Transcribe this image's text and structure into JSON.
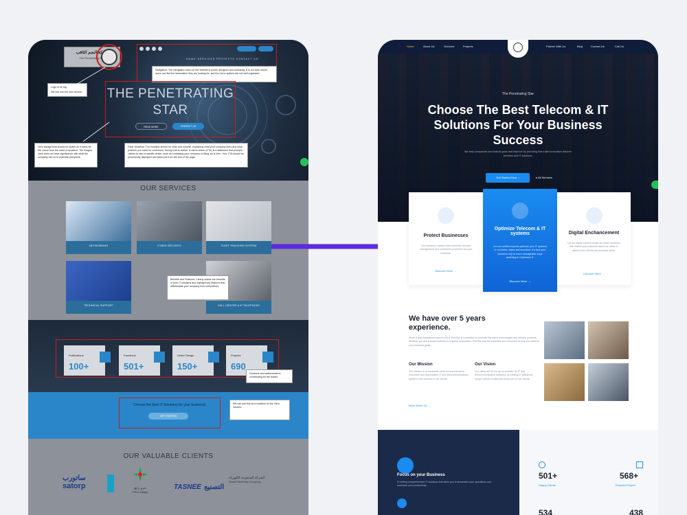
{
  "left": {
    "hero": {
      "logo_arabic": "شركة النجم الثاقب",
      "logo_english": "The Penetrating Star",
      "title_line1": "THE PENETRATING",
      "title_line2": "STAR",
      "btn_primary": "READ MORE",
      "btn_secondary": "CONTACT US",
      "nav_menu": "HOME   SERVICES   PROJECTS   CONTACT US"
    },
    "notes": {
      "logo": "Logo to be big.",
      "logo_sub": "We can use the new version",
      "nav": "Navigation: The navigation menu on the website is poorly designed and confusing. It is not clear where users can find the information they are looking for, and the menu options are not well-organized.",
      "background": "Hero background should be stylish as it does not the colour from the value proposition. The images used does not have significance with what the company can do to potential prospects.",
      "headline": "Clear Headline: The headline should be clear and concise, explaining what your company does and what problem you solve for customers. Strong Call-to-Action: A call-to-action (CTA) is a statement that prompts visitors to take a specific action, such as contacting your company or filling out a form. Your CTA should be prominently displayed and stand out from the rest of the page.",
      "services": "Benefits and Features: Clearly outline the benefits of your IT solutions and highlight key features that differentiate your company from competitors.",
      "stats": "Numbers and testimonials to contributing for the reader.",
      "cta": "We can use this as a headline for the Hero Section."
    },
    "services": {
      "title": "OUR SERVICES",
      "items": [
        {
          "label": "NETWORKING"
        },
        {
          "label": "CYBER SECURITY"
        },
        {
          "label": "FLEET TRACKING SYSTEM"
        },
        {
          "label": "TECHNICAL SUPPORT"
        },
        {
          "label": "CALL CENTER & IP TELEPHONY"
        }
      ]
    },
    "stats": [
      {
        "label": "Publications",
        "value": "100+"
      },
      {
        "label": "Facebook",
        "value": "501+"
      },
      {
        "label": "Under Design",
        "value": "150+"
      },
      {
        "label": "Projects",
        "value": "690"
      }
    ],
    "cta": {
      "text": "Choose the best IT Solutions for your business!",
      "button": "GET STARTED"
    },
    "clients": {
      "title": "OUR VALUABLE CLIENTS",
      "items": [
        {
          "name": "satorp",
          "arabic": "ساتورب"
        },
        {
          "name": "Petro Rabigh",
          "arabic": "بترو رابغ"
        },
        {
          "name": "TASNEE",
          "arabic": "التصنيع"
        },
        {
          "name": "Saudi Electricity Company",
          "arabic": "الشركة السعودية للكهرباء"
        }
      ]
    }
  },
  "right": {
    "nav": {
      "left_items": [
        "Home",
        "About Us",
        "Services",
        "Projects"
      ],
      "right_items": [
        "Partner With Us",
        "Blog",
        "Contact Us",
        "Call Us"
      ]
    },
    "hero": {
      "subtitle": "The Penetrating Star",
      "title": "Choose The Best Telecom & IT Solutions For Your Business Success",
      "description": "We help companies and brands grow and improve by providing them with innovative telecom services and IT solutions.",
      "btn_primary": "Get Started Now",
      "btn_secondary": "All Services"
    },
    "cards": [
      {
        "title": "Protect Businesses",
        "description": "Our industry's solution that combines security management and convenient protection for your business.",
        "link": "Discover More"
      },
      {
        "title": "Optimize Telecom & IT systems",
        "description": "Let our certified experts optimize your IT systems to run better, faster and smoother. It's time your business rely on more manageable ways switching to Optimized IT.",
        "link": "Discover More"
      },
      {
        "title": "Digital Enchancement",
        "description": "Let our digital experts create an online presence that makes your business stand out online to attract more clients and increase sales.",
        "link": "Discover More"
      }
    ],
    "experience": {
      "title": "We have over 5 years experience.",
      "description": "Since it was established back in 2018, PenStar is committed to innovate the latest technologies and reliable products. Whether you are a small business or a global corporation, PenStar has the expertise and resources to help you achieve your business goals.",
      "mission_title": "Our Mission",
      "mission_text": "Our mission is to constantly seek out and introduce innovative and dependable IT and telecommunications systems and services to our clients.",
      "vision_title": "Our Vision",
      "vision_text": "Our vision are for the go-to provider for IT and telecommunication solutions, by striving to satisfy the unique needs of each and every one of our clients.",
      "more": "More About Us"
    },
    "focus": {
      "title": "Focus on your Business",
      "description": "Providing comprehensive IT solutions that allow you to streamline your operations and maximize your productivity."
    },
    "stats": [
      {
        "value": "501+",
        "label": "Happy Clients"
      },
      {
        "value": "568+",
        "label": "Finished Project"
      },
      {
        "value": "534",
        "label": ""
      },
      {
        "value": "438",
        "label": ""
      }
    ]
  },
  "colors": {
    "accent_blue": "#1a8cf0",
    "annotation_red": "#c71e1e",
    "arrow_purple": "#5b2be0",
    "dark_navy": "#0f1d3a"
  }
}
